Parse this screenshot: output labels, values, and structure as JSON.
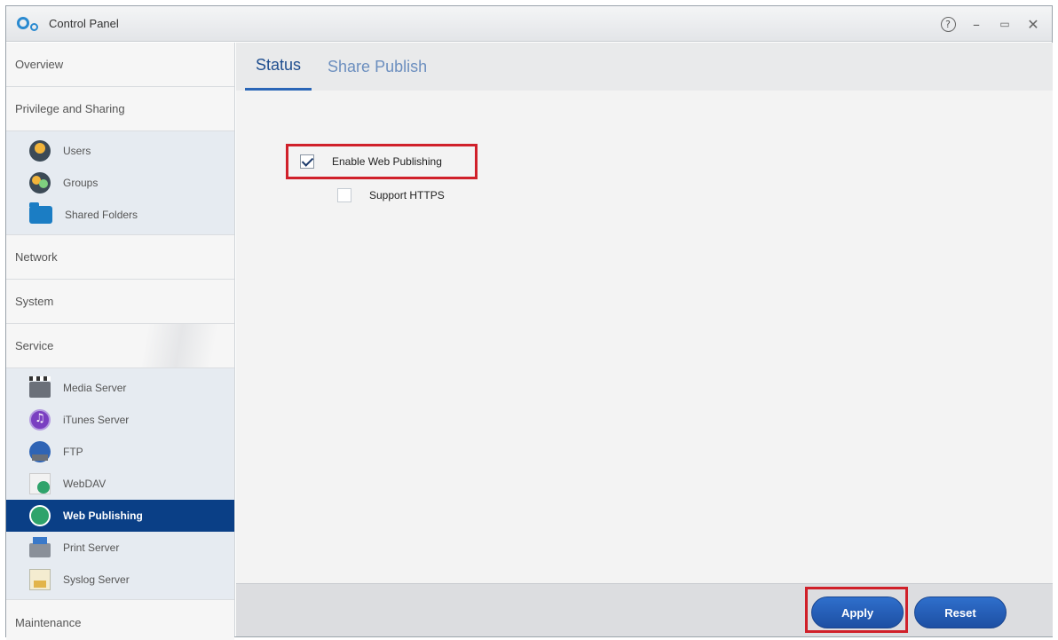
{
  "window": {
    "title": "Control Panel"
  },
  "sidebar": {
    "sections": {
      "overview": "Overview",
      "privilege": "Privilege and Sharing",
      "network": "Network",
      "system": "System",
      "service": "Service",
      "maintenance": "Maintenance"
    },
    "privilege_items": [
      {
        "label": "Users",
        "icon": "user-icon"
      },
      {
        "label": "Groups",
        "icon": "groups-icon"
      },
      {
        "label": "Shared Folders",
        "icon": "folder-icon"
      }
    ],
    "service_items": [
      {
        "label": "Media Server",
        "icon": "media-server-icon"
      },
      {
        "label": "iTunes Server",
        "icon": "itunes-icon"
      },
      {
        "label": "FTP",
        "icon": "ftp-icon"
      },
      {
        "label": "WebDAV",
        "icon": "webdav-icon"
      },
      {
        "label": "Web Publishing",
        "icon": "web-publishing-icon",
        "selected": true
      },
      {
        "label": "Print Server",
        "icon": "printer-icon"
      },
      {
        "label": "Syslog Server",
        "icon": "syslog-icon"
      }
    ]
  },
  "tabs": [
    {
      "label": "Status",
      "active": true
    },
    {
      "label": "Share Publish",
      "active": false
    }
  ],
  "options": {
    "enable_web_publishing": {
      "label": "Enable Web Publishing",
      "checked": true
    },
    "support_https": {
      "label": "Support HTTPS",
      "checked": false
    }
  },
  "buttons": {
    "apply": "Apply",
    "reset": "Reset"
  },
  "colors": {
    "selected": "#0a3f86",
    "accent": "#1f4e8f",
    "highlight": "#d0202a"
  }
}
